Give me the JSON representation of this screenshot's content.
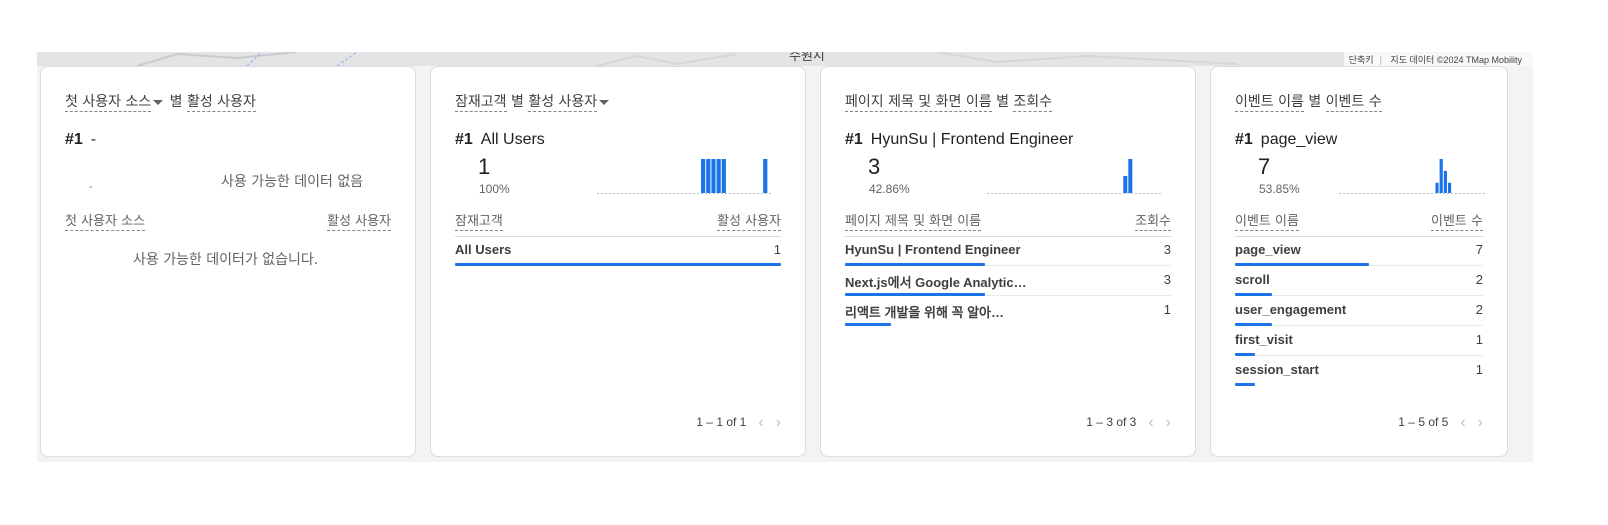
{
  "map": {
    "label": "수원시",
    "attribution": [
      "단축키",
      "지도 데이터 ©2024 TMap Mobility"
    ]
  },
  "cards": [
    {
      "title_part1": "첫 사용자 소스",
      "title_part2": "별",
      "title_part3": "활성 사용자",
      "rank_num": "#1",
      "rank_name": "-",
      "no_data_short": "사용 가능한 데이터 없음",
      "dash": "-",
      "col_left": "첫 사용자 소스",
      "col_right": "활성 사용자",
      "no_data_long": "사용 가능한 데이터가 없습니다."
    },
    {
      "title_part1": "잠재고객",
      "title_part2": "별",
      "title_part3": "활성 사용자",
      "rank_num": "#1",
      "rank_name": "All Users",
      "big_value": "1",
      "percent": "100%",
      "sparkline": [
        0,
        0,
        0,
        0,
        0,
        0,
        0,
        0,
        0,
        0,
        0,
        0,
        0,
        0,
        0,
        0,
        0,
        0,
        0,
        0,
        1,
        1,
        1,
        1,
        1,
        0,
        0,
        0,
        0,
        0,
        0,
        0,
        1,
        0
      ],
      "col_left": "잠재고객",
      "col_right": "활성 사용자",
      "rows": [
        {
          "label": "All Users",
          "value": "1",
          "share": 1.0
        }
      ],
      "pager": "1 – 1 of 1"
    },
    {
      "title_part1": "페이지 제목 및 화면 이름",
      "title_part2": "별",
      "title_part3": "조회수",
      "rank_num": "#1",
      "rank_name": "HyunSu | Frontend Engineer",
      "big_value": "3",
      "percent": "42.86%",
      "sparkline": [
        0,
        0,
        0,
        0,
        0,
        0,
        0,
        0,
        0,
        0,
        0,
        0,
        0,
        0,
        0,
        0,
        0,
        0,
        0,
        0,
        0,
        0,
        0,
        0,
        0,
        0,
        0,
        0.5,
        1,
        0,
        0,
        0,
        0,
        0,
        0
      ],
      "col_left": "페이지 제목 및 화면 이름",
      "col_right": "조회수",
      "rows": [
        {
          "label": "HyunSu | Frontend Engineer",
          "value": "3",
          "share": 0.43
        },
        {
          "label": "Next.js에서 Google Analytic…",
          "value": "3",
          "share": 0.43
        },
        {
          "label": "리액트 개발을 위해 꼭 알아…",
          "value": "1",
          "share": 0.14
        }
      ],
      "pager": "1 – 3 of 3"
    },
    {
      "title_part1": "이벤트 이름",
      "title_part2": "별",
      "title_part3": "이벤트 수",
      "rank_num": "#1",
      "rank_name": "page_view",
      "big_value": "7",
      "percent": "53.85%",
      "sparkline": [
        0,
        0,
        0,
        0,
        0,
        0,
        0,
        0,
        0,
        0,
        0,
        0,
        0,
        0,
        0,
        0,
        0,
        0,
        0,
        0,
        0,
        0,
        0,
        0.3,
        1,
        0.65,
        0.3,
        0,
        0,
        0,
        0,
        0,
        0,
        0,
        0
      ],
      "col_left": "이벤트 이름",
      "col_right": "이벤트 수",
      "rows": [
        {
          "label": "page_view",
          "value": "7",
          "share": 0.54
        },
        {
          "label": "scroll",
          "value": "2",
          "share": 0.15
        },
        {
          "label": "user_engagement",
          "value": "2",
          "share": 0.15
        },
        {
          "label": "first_visit",
          "value": "1",
          "share": 0.08
        },
        {
          "label": "session_start",
          "value": "1",
          "share": 0.08
        }
      ],
      "pager": "1 – 5 of 5"
    }
  ],
  "colors": {
    "accent": "#1a73e8",
    "border": "#dadce0",
    "muted": "#5f6368"
  }
}
